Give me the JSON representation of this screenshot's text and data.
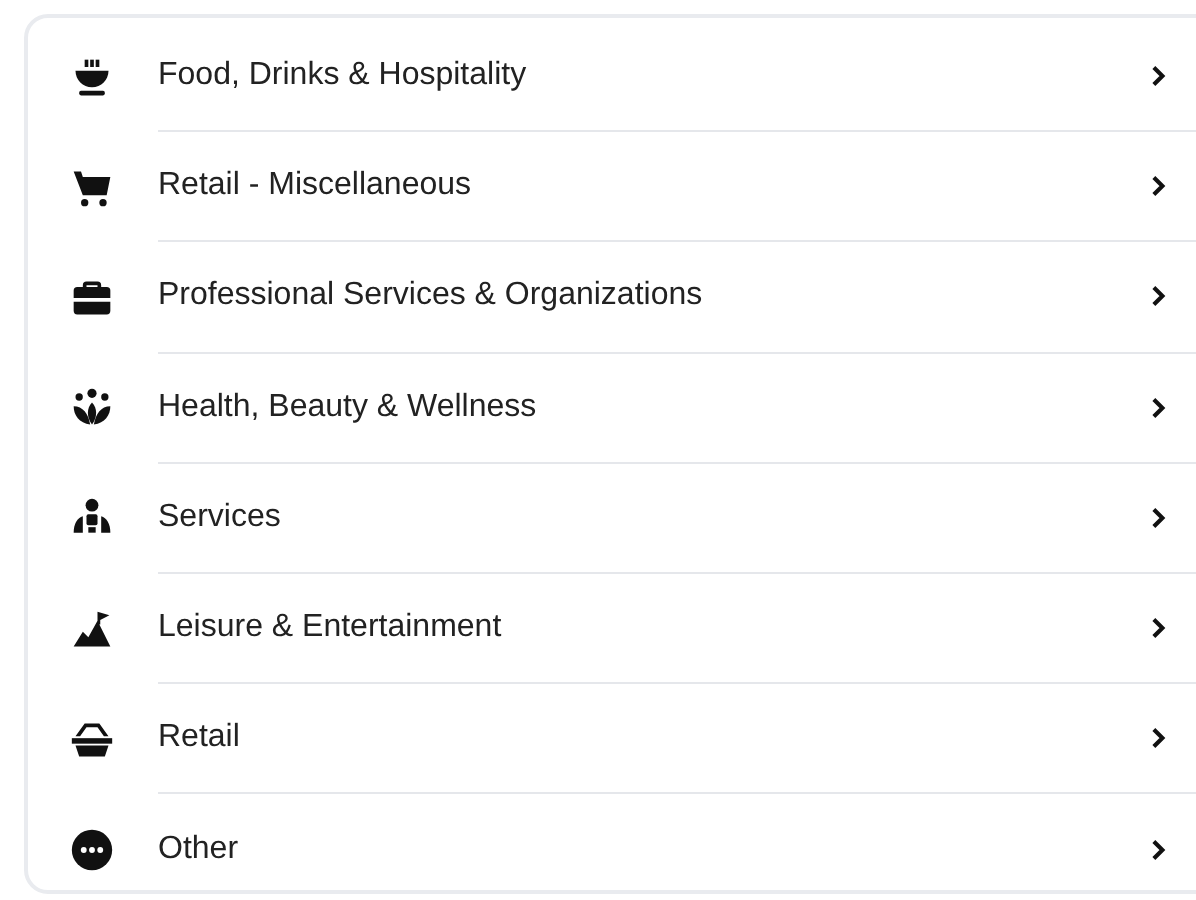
{
  "categories": [
    {
      "label": "Food, Drinks & Hospitality",
      "kind": "food"
    },
    {
      "label": "Retail - Miscellaneous",
      "kind": "cart"
    },
    {
      "label": "Professional Services & Organizations",
      "kind": "briefcase"
    },
    {
      "label": "Health, Beauty & Wellness",
      "kind": "lotus"
    },
    {
      "label": "Services",
      "kind": "person"
    },
    {
      "label": "Leisure & Entertainment",
      "kind": "mountain"
    },
    {
      "label": "Retail",
      "kind": "basket"
    },
    {
      "label": "Other",
      "kind": "dots"
    }
  ]
}
